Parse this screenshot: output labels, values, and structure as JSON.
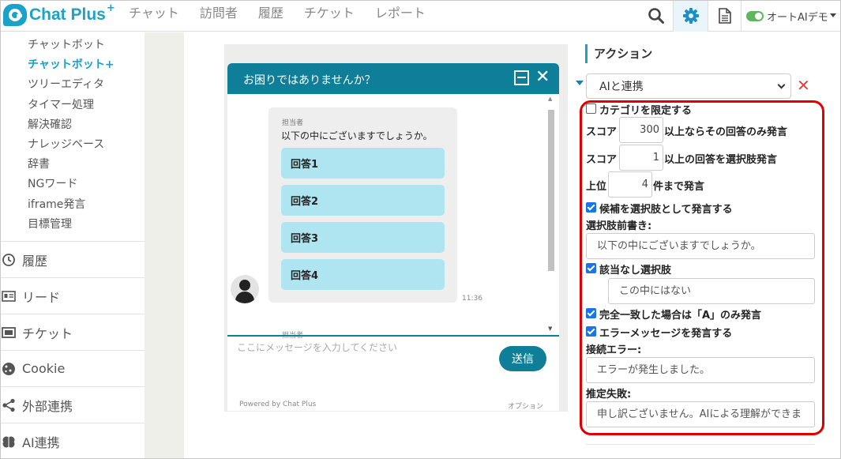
{
  "app": {
    "name": "Chat Plus",
    "plus": "+"
  },
  "nav": [
    "チャット",
    "訪問者",
    "履歴",
    "チケット",
    "レポート"
  ],
  "topbar": {
    "account_label": "オートAIデモ"
  },
  "sidebar": {
    "sub_items": [
      {
        "label": "チャットボット",
        "active": false
      },
      {
        "label": "チャットボット+",
        "active": true
      },
      {
        "label": "ツリーエディタ",
        "active": false
      },
      {
        "label": "タイマー処理",
        "active": false
      },
      {
        "label": "解決確認",
        "active": false
      },
      {
        "label": "ナレッジベース",
        "active": false
      },
      {
        "label": "辞書",
        "active": false
      },
      {
        "label": "NGワード",
        "active": false
      },
      {
        "label": "iframe発言",
        "active": false
      },
      {
        "label": "目標管理",
        "active": false
      }
    ],
    "main_items": [
      {
        "label": "履歴",
        "icon": "history-icon"
      },
      {
        "label": "リード",
        "icon": "id-card-icon"
      },
      {
        "label": "チケット",
        "icon": "ticket-icon"
      },
      {
        "label": "Cookie",
        "icon": "cookie-icon"
      },
      {
        "label": "外部連携",
        "icon": "share-icon"
      },
      {
        "label": "AI連携",
        "icon": "brain-icon"
      }
    ]
  },
  "chat": {
    "header_title": "お困りではありませんか？",
    "sender": "担当者",
    "message": "以下の中にございますでしょうか。",
    "choices": [
      "回答1",
      "回答2",
      "回答3",
      "回答4"
    ],
    "time": "11:36",
    "next_sender": "担当者",
    "input_placeholder": "ここにメッセージを入力してください",
    "send_label": "送信",
    "powered_by": "Powered by Chat Plus",
    "option_label": "オプション"
  },
  "action": {
    "section_title": "アクション",
    "selected": "AIと連携",
    "limit_category": {
      "label": "カテゴリを限定する",
      "checked": false
    },
    "score_only": {
      "prefix": "スコア",
      "value": "300",
      "suffix": "以上ならその回答のみ発言"
    },
    "score_choice": {
      "prefix": "スコア",
      "value": "1",
      "suffix": "以上の回答を選択肢発言"
    },
    "top_n": {
      "prefix": "上位",
      "value": "4",
      "suffix": "件まで発言"
    },
    "as_choices": {
      "label": "候補を選択肢として発言する",
      "checked": true
    },
    "preface_label": "選択肢前書き:",
    "preface_value": "以下の中にございますでしょうか。",
    "no_match": {
      "label": "該当なし選択肢",
      "checked": true
    },
    "no_match_value": "この中にはない",
    "exact_match": {
      "label": "完全一致した場合は「A」のみ発言",
      "checked": true
    },
    "error_msg": {
      "label": "エラーメッセージを発言する",
      "checked": true
    },
    "conn_error_label": "接続エラー:",
    "conn_error_value": "エラーが発生しました。",
    "infer_fail_label": "推定失敗:",
    "infer_fail_value": "申し訳ございません。AIによる理解ができま"
  }
}
